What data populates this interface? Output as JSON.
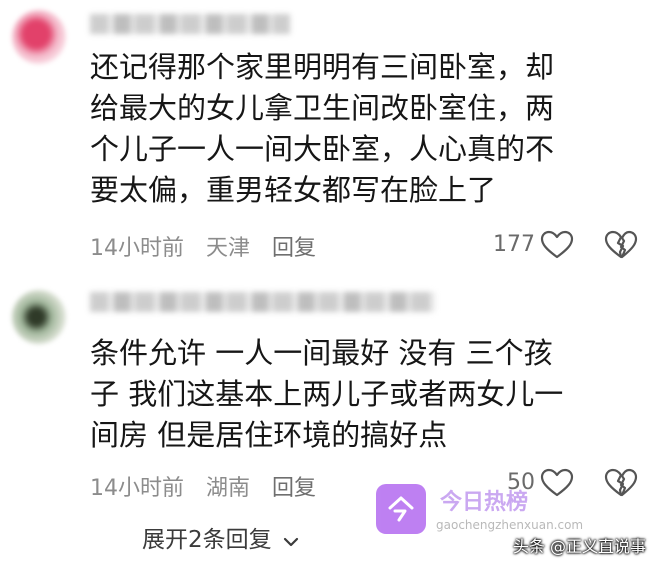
{
  "comments": [
    {
      "text": "还记得那个家里明明有三间卧室，却\n给最大的女儿拿卫生间改卧室住，两\n个儿子一人一间大卧室，人心真的不\n要太偏，重男轻女都写在脸上了",
      "time": "14小时前",
      "location": "天津",
      "reply_label": "回复",
      "like_count": "177"
    },
    {
      "text": "条件允许 一人一间最好 没有 三个孩\n子 我们这基本上两儿子或者两女儿一\n间房 但是居住环境的搞好点",
      "time": "14小时前",
      "location": "湖南",
      "reply_label": "回复",
      "like_count": "50"
    }
  ],
  "expand_replies": "展开2条回复",
  "watermark": {
    "title": "今日热榜",
    "url": "gaochengzhenxuan.com",
    "color": "#b36bf0"
  },
  "source_label": "头条 @正义直说事",
  "icons": {
    "like": "heart-outline-icon",
    "dislike": "broken-heart-icon",
    "expand": "chevron-down-icon"
  }
}
